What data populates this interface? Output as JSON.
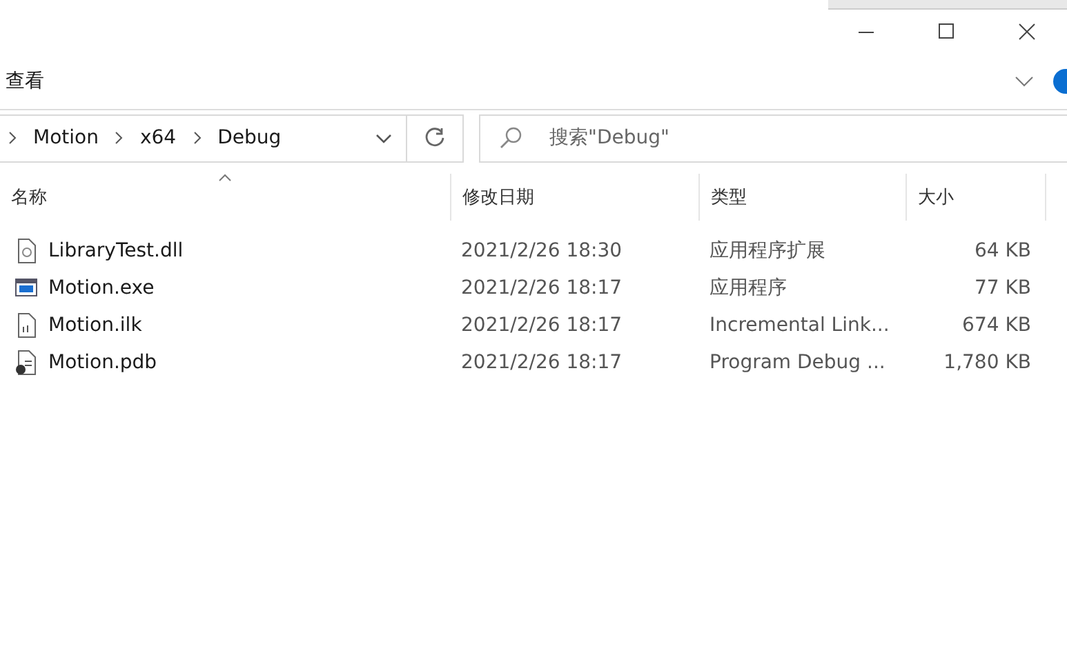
{
  "ribbon": {
    "tab": "查看"
  },
  "address_bar": {
    "crumbs": [
      "Motion",
      "x64",
      "Debug"
    ]
  },
  "search": {
    "placeholder": "搜索\"Debug\""
  },
  "table": {
    "columns": [
      {
        "label": "名称",
        "sorted": true
      },
      {
        "label": "修改日期",
        "sorted": false
      },
      {
        "label": "类型",
        "sorted": false
      },
      {
        "label": "大小",
        "sorted": false
      }
    ],
    "rows": [
      {
        "kind": "dll",
        "name": "LibraryTest.dll",
        "date": "2021/2/26 18:30",
        "type": "应用程序扩展",
        "size": "64 KB"
      },
      {
        "kind": "exe",
        "name": "Motion.exe",
        "date": "2021/2/26 18:17",
        "type": "应用程序",
        "size": "77 KB"
      },
      {
        "kind": "ilk",
        "name": "Motion.ilk",
        "date": "2021/2/26 18:17",
        "type": "Incremental Link...",
        "size": "674 KB"
      },
      {
        "kind": "pdb",
        "name": "Motion.pdb",
        "date": "2021/2/26 18:17",
        "type": "Program Debug ...",
        "size": "1,780 KB"
      }
    ]
  }
}
